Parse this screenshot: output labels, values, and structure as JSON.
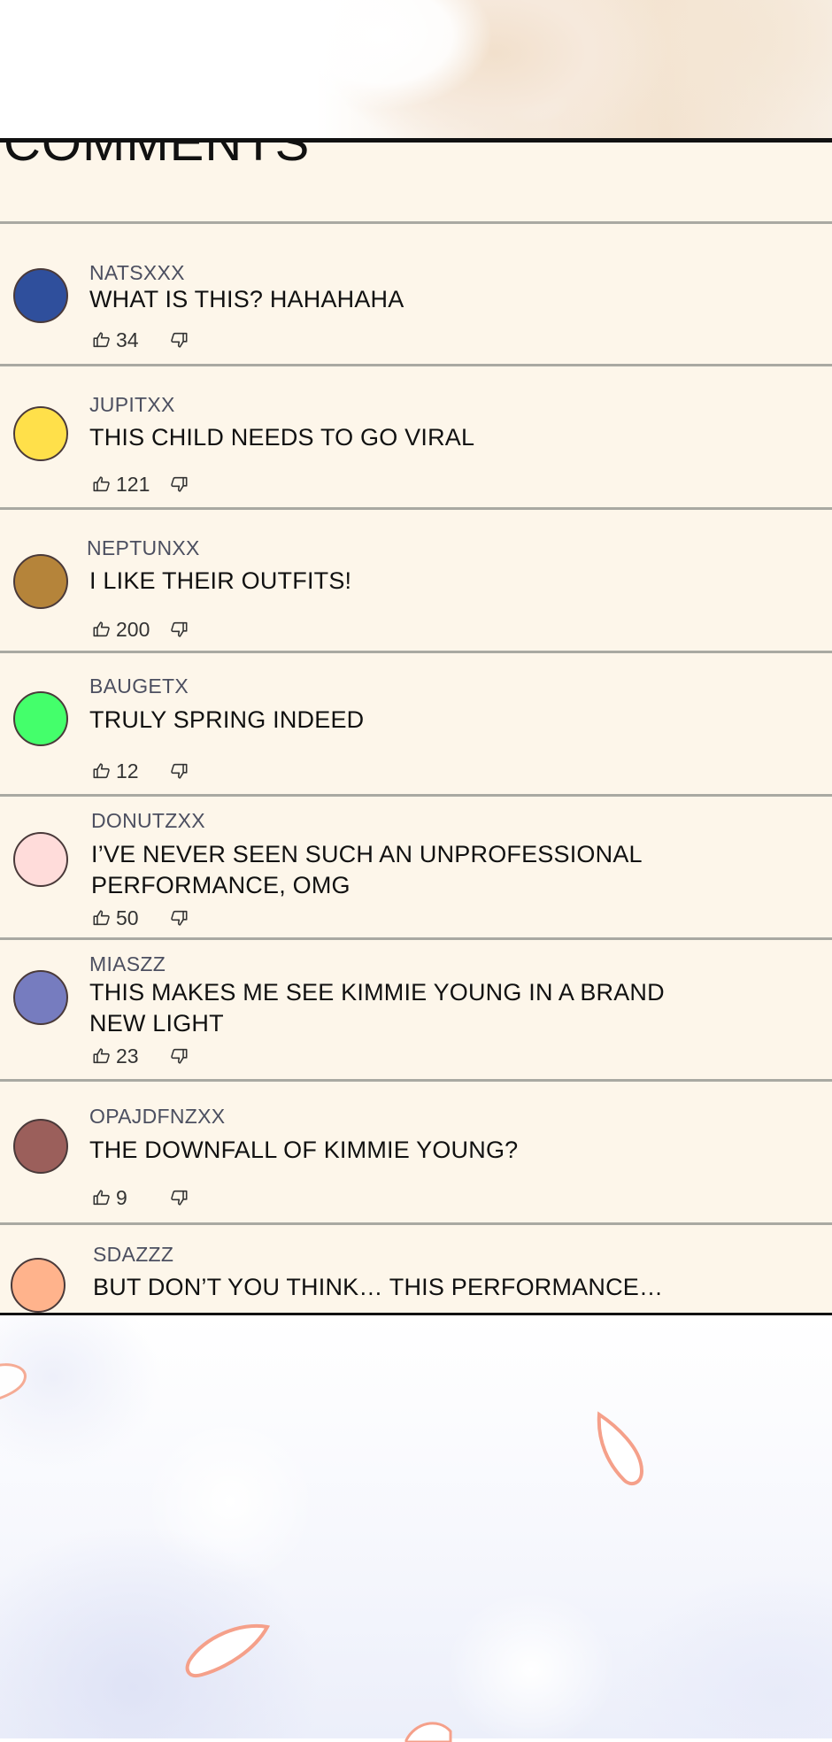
{
  "panel": {
    "title": "COMMENTS"
  },
  "comments": [
    {
      "username": "NATSXXX",
      "text": "WHAT IS THIS? HAHAHAHA",
      "likes": "34",
      "avatar_color": "#2f4f9c"
    },
    {
      "username": "JUPITXX",
      "text": "THIS CHILD NEEDS TO GO VIRAL",
      "likes": "121",
      "avatar_color": "#ffe04a"
    },
    {
      "username": "NEPTUNXX",
      "text": "I LIKE THEIR OUTFITS!",
      "likes": "200",
      "avatar_color": "#b5843a"
    },
    {
      "username": "BAUGETX",
      "text": "TRULY SPRING INDEED",
      "likes": "12",
      "avatar_color": "#44ff6b"
    },
    {
      "username": "DONUTZXX",
      "text": "I’VE NEVER SEEN SUCH AN UNPROFESSIONAL PERFORMANCE, OMG",
      "likes": "50",
      "avatar_color": "#ffdcda"
    },
    {
      "username": "MIASZZ",
      "text": "THIS MAKES ME SEE KIMMIE YOUNG IN A BRAND NEW LIGHT",
      "likes": "23",
      "avatar_color": "#767cbf"
    },
    {
      "username": "OPAJDFNZXX",
      "text": "THE DOWNFALL OF KIMMIE YOUNG?",
      "likes": "9",
      "avatar_color": "#9b5f5b"
    },
    {
      "username": "SDAZZZ",
      "text": "BUT DON’T YOU THINK… THIS PERFORMANCE…",
      "likes": "",
      "avatar_color": "#ffb38c"
    }
  ],
  "icons": {
    "like": "thumbs-up-icon",
    "dislike": "thumbs-down-icon"
  }
}
